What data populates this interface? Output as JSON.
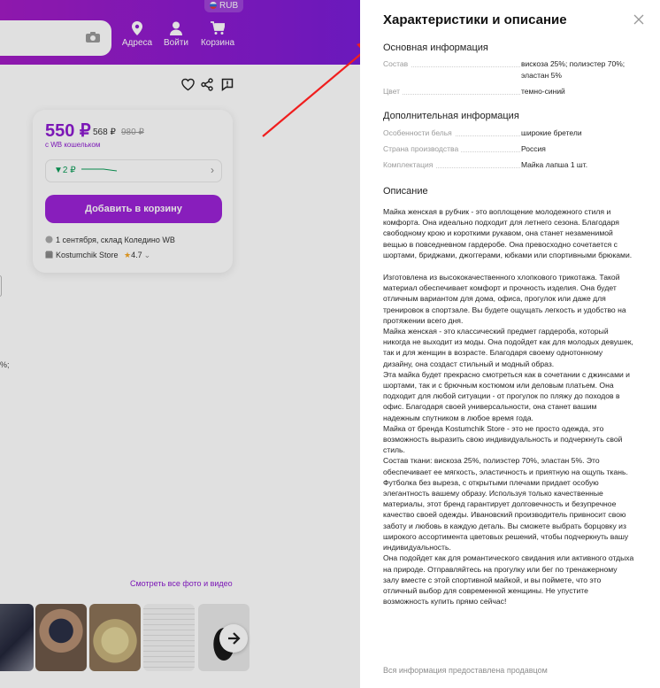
{
  "header": {
    "currency": "RUB",
    "nav": [
      {
        "label": "Адреса",
        "icon": "location-pin-icon"
      },
      {
        "label": "Войти",
        "icon": "user-icon"
      },
      {
        "label": "Корзина",
        "icon": "cart-icon"
      }
    ]
  },
  "product_card": {
    "price": "550 ₽",
    "old_price": "568 ₽",
    "strike_price": "980 ₽",
    "wallet_label": "с WB кошельком",
    "price_drop": "▼2 ₽",
    "add_to_cart": "Добавить в корзину",
    "delivery": "1 сентября, склад Коледино WB",
    "store": "Kostumchik Store",
    "rating": "4.7"
  },
  "gallery": {
    "see_all": "Смотреть все фото и видео"
  },
  "left_fragment": "%;",
  "panel": {
    "title": "Характеристики и описание",
    "basic_info_heading": "Основная информация",
    "basic_info": [
      {
        "key": "Состав",
        "value": "вискоза 25%; полиэстер 70%; эластан 5%"
      },
      {
        "key": "Цвет",
        "value": "темно-синий"
      }
    ],
    "extra_info_heading": "Дополнительная информация",
    "extra_info": [
      {
        "key": "Особенности белья",
        "value": "широкие бретели"
      },
      {
        "key": "Страна производства",
        "value": "Россия"
      },
      {
        "key": "Комплектация",
        "value": "Майка лапша 1 шт."
      }
    ],
    "description_heading": "Описание",
    "description_paragraphs": [
      "Майка женская в рубчик - это воплощение молодежного стиля и комфорта. Она идеально подходит для летнего сезона. Благодаря свободному крою и короткими рукавом, она станет незаменимой вещью в повседневном гардеробе. Она превосходно сочетается с шортами, бриджами, джоггерами, юбками или спортивными брюками.",
      "Изготовлена из высококачественного хлопкового трикотажа. Такой материал обеспечивает комфорт и прочность изделия. Она будет отличным вариантом для дома, офиса, прогулок или даже для тренировок в спортзале. Вы будете ощущать легкость и удобство на протяжении всего дня.",
      "Майка женская - это классический предмет гардероба, который никогда не выходит из моды. Она подойдет как для молодых девушек, так и для женщин в возрасте. Благодаря своему однотонному дизайну, она создаст стильный и модный образ.",
      "Эта майка будет прекрасно смотреться как в сочетании с джинсами и шортами, так и с брючным костюмом или деловым платьем. Она подходит для любой ситуации - от прогулок по пляжу до походов в офис. Благодаря своей универсальности, она станет вашим надежным спутником в любое время года.",
      "Майка от бренда Kostumchik Store - это не просто одежда, это возможность выразить свою индивидуальность и подчеркнуть свой стиль.",
      "Состав ткани: вискоза 25%, полиэстер 70%, эластан 5%. Это обеспечивает ее мягкость, эластичность и приятную на ощупь ткань. Футболка без выреза, с открытыми плечами придает особую элегантность вашему образу. Используя только качественные материалы, этот бренд гарантирует долговечность и безупречное качество своей одежды. Ивановский производитель привносит свою заботу и любовь в каждую деталь. Вы сможете выбрать борцовку из широкого ассортимента цветовых решений, чтобы подчеркнуть вашу индивидуальность.",
      "Она подойдет как для романтического свидания или активного отдыха на природе. Отправляйтесь на прогулку или бег по тренажерному залу вместе с этой спортивной майкой, и вы поймете, что это отличный выбор для современной женщины. Не упустите возможность купить прямо сейчас!"
    ],
    "footnote": "Вся информация предоставлена продавцом"
  },
  "colors": {
    "brand": "#8c1bd0",
    "annotation_arrow": "#f01e1e"
  }
}
